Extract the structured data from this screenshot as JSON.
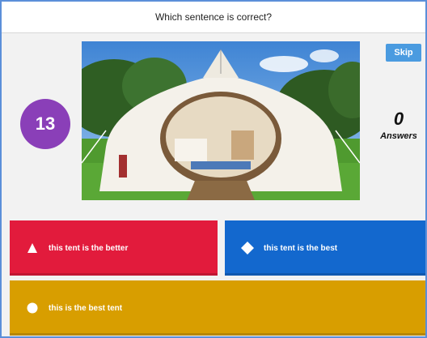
{
  "question": {
    "text": "Which sentence is correct?"
  },
  "timer": {
    "value": "13"
  },
  "controls": {
    "skip_label": "Skip"
  },
  "answers_panel": {
    "count": "0",
    "label": "Answers"
  },
  "answers": [
    {
      "text": "this tent is the better",
      "color": "#e21b3c",
      "shape": "triangle-icon"
    },
    {
      "text": "this tent is the best",
      "color": "#1368ce",
      "shape": "diamond-icon"
    },
    {
      "text": "this is the best tent",
      "color": "#d89e00",
      "shape": "circle-icon"
    }
  ]
}
